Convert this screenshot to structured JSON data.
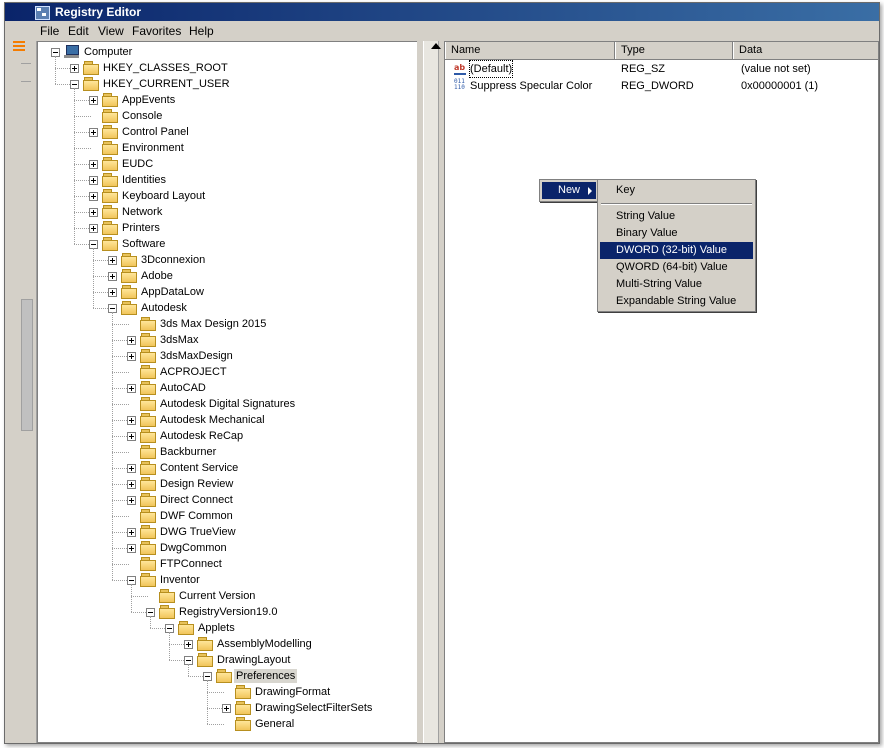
{
  "window": {
    "title": "Registry Editor"
  },
  "menu": [
    "File",
    "Edit",
    "View",
    "Favorites",
    "Help"
  ],
  "tree": [
    {
      "label": "Computer",
      "depth": 0,
      "exp": "minus",
      "icon": "computer"
    },
    {
      "label": "HKEY_CLASSES_ROOT",
      "depth": 1,
      "exp": "plus"
    },
    {
      "label": "HKEY_CURRENT_USER",
      "depth": 1,
      "exp": "minus"
    },
    {
      "label": "AppEvents",
      "depth": 2,
      "exp": "plus"
    },
    {
      "label": "Console",
      "depth": 2,
      "exp": "none"
    },
    {
      "label": "Control Panel",
      "depth": 2,
      "exp": "plus"
    },
    {
      "label": "Environment",
      "depth": 2,
      "exp": "none"
    },
    {
      "label": "EUDC",
      "depth": 2,
      "exp": "plus"
    },
    {
      "label": "Identities",
      "depth": 2,
      "exp": "plus"
    },
    {
      "label": "Keyboard Layout",
      "depth": 2,
      "exp": "plus"
    },
    {
      "label": "Network",
      "depth": 2,
      "exp": "plus"
    },
    {
      "label": "Printers",
      "depth": 2,
      "exp": "plus"
    },
    {
      "label": "Software",
      "depth": 2,
      "exp": "minus"
    },
    {
      "label": "3Dconnexion",
      "depth": 3,
      "exp": "plus"
    },
    {
      "label": "Adobe",
      "depth": 3,
      "exp": "plus"
    },
    {
      "label": "AppDataLow",
      "depth": 3,
      "exp": "plus"
    },
    {
      "label": "Autodesk",
      "depth": 3,
      "exp": "minus"
    },
    {
      "label": "3ds Max Design 2015",
      "depth": 4,
      "exp": "none"
    },
    {
      "label": "3dsMax",
      "depth": 4,
      "exp": "plus"
    },
    {
      "label": "3dsMaxDesign",
      "depth": 4,
      "exp": "plus"
    },
    {
      "label": "ACPROJECT",
      "depth": 4,
      "exp": "none"
    },
    {
      "label": "AutoCAD",
      "depth": 4,
      "exp": "plus"
    },
    {
      "label": "Autodesk Digital Signatures",
      "depth": 4,
      "exp": "none"
    },
    {
      "label": "Autodesk Mechanical",
      "depth": 4,
      "exp": "plus"
    },
    {
      "label": "Autodesk ReCap",
      "depth": 4,
      "exp": "plus"
    },
    {
      "label": "Backburner",
      "depth": 4,
      "exp": "none"
    },
    {
      "label": "Content Service",
      "depth": 4,
      "exp": "plus"
    },
    {
      "label": "Design Review",
      "depth": 4,
      "exp": "plus"
    },
    {
      "label": "Direct Connect",
      "depth": 4,
      "exp": "plus"
    },
    {
      "label": "DWF Common",
      "depth": 4,
      "exp": "none"
    },
    {
      "label": "DWG TrueView",
      "depth": 4,
      "exp": "plus"
    },
    {
      "label": "DwgCommon",
      "depth": 4,
      "exp": "plus"
    },
    {
      "label": "FTPConnect",
      "depth": 4,
      "exp": "none"
    },
    {
      "label": "Inventor",
      "depth": 4,
      "exp": "minus"
    },
    {
      "label": "Current Version",
      "depth": 5,
      "exp": "none"
    },
    {
      "label": "RegistryVersion19.0",
      "depth": 5,
      "exp": "minus"
    },
    {
      "label": "Applets",
      "depth": 6,
      "exp": "minus"
    },
    {
      "label": "AssemblyModelling",
      "depth": 7,
      "exp": "plus"
    },
    {
      "label": "DrawingLayout",
      "depth": 7,
      "exp": "minus"
    },
    {
      "label": "Preferences",
      "depth": 8,
      "exp": "minus",
      "selected": true
    },
    {
      "label": "DrawingFormat",
      "depth": 9,
      "exp": "none"
    },
    {
      "label": "DrawingSelectFilterSets",
      "depth": 9,
      "exp": "plus"
    },
    {
      "label": "General",
      "depth": 9,
      "exp": "none"
    }
  ],
  "values": {
    "columns": [
      "Name",
      "Type",
      "Data"
    ],
    "rows": [
      {
        "name": "(Default)",
        "type": "REG_SZ",
        "data": "(value not set)",
        "icon": "string-value-icon"
      },
      {
        "name": "Suppress Specular Color",
        "type": "REG_DWORD",
        "data": "0x00000001 (1)",
        "icon": "binary-value-icon"
      }
    ]
  },
  "context_menu": {
    "label": "New"
  },
  "submenu": {
    "first": "Key",
    "items": [
      "String Value",
      "Binary Value",
      "DWORD (32-bit) Value",
      "QWORD (64-bit) Value",
      "Multi-String Value",
      "Expandable String Value"
    ],
    "highlighted": "DWORD (32-bit) Value"
  },
  "colors": {
    "highlight": "#0a246a",
    "title_bar": "#0a246a",
    "folder": "#f1c55a"
  }
}
